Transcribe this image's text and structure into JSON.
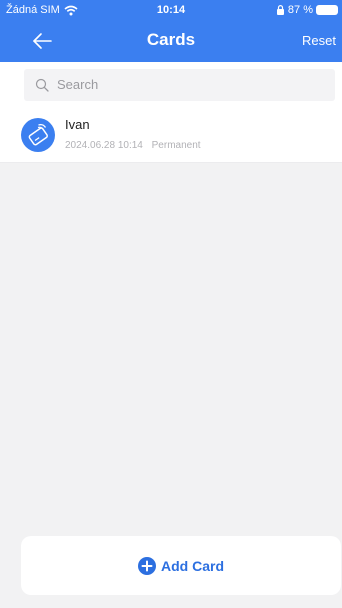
{
  "status_bar": {
    "carrier": "Žádná SIM",
    "time": "10:14",
    "battery": "87 %"
  },
  "nav": {
    "title": "Cards",
    "reset_label": "Reset"
  },
  "search": {
    "placeholder": "Search"
  },
  "cards": [
    {
      "name": "Ivan",
      "datetime": "2024.06.28 10:14",
      "validity": "Permanent",
      "icon": "card-icon"
    }
  ],
  "footer": {
    "add_label": "Add Card",
    "icon": "plus-circle-icon"
  },
  "colors": {
    "accent": "#3b7ff0",
    "background": "#f2f2f3",
    "add_text": "#2c6fe0"
  }
}
